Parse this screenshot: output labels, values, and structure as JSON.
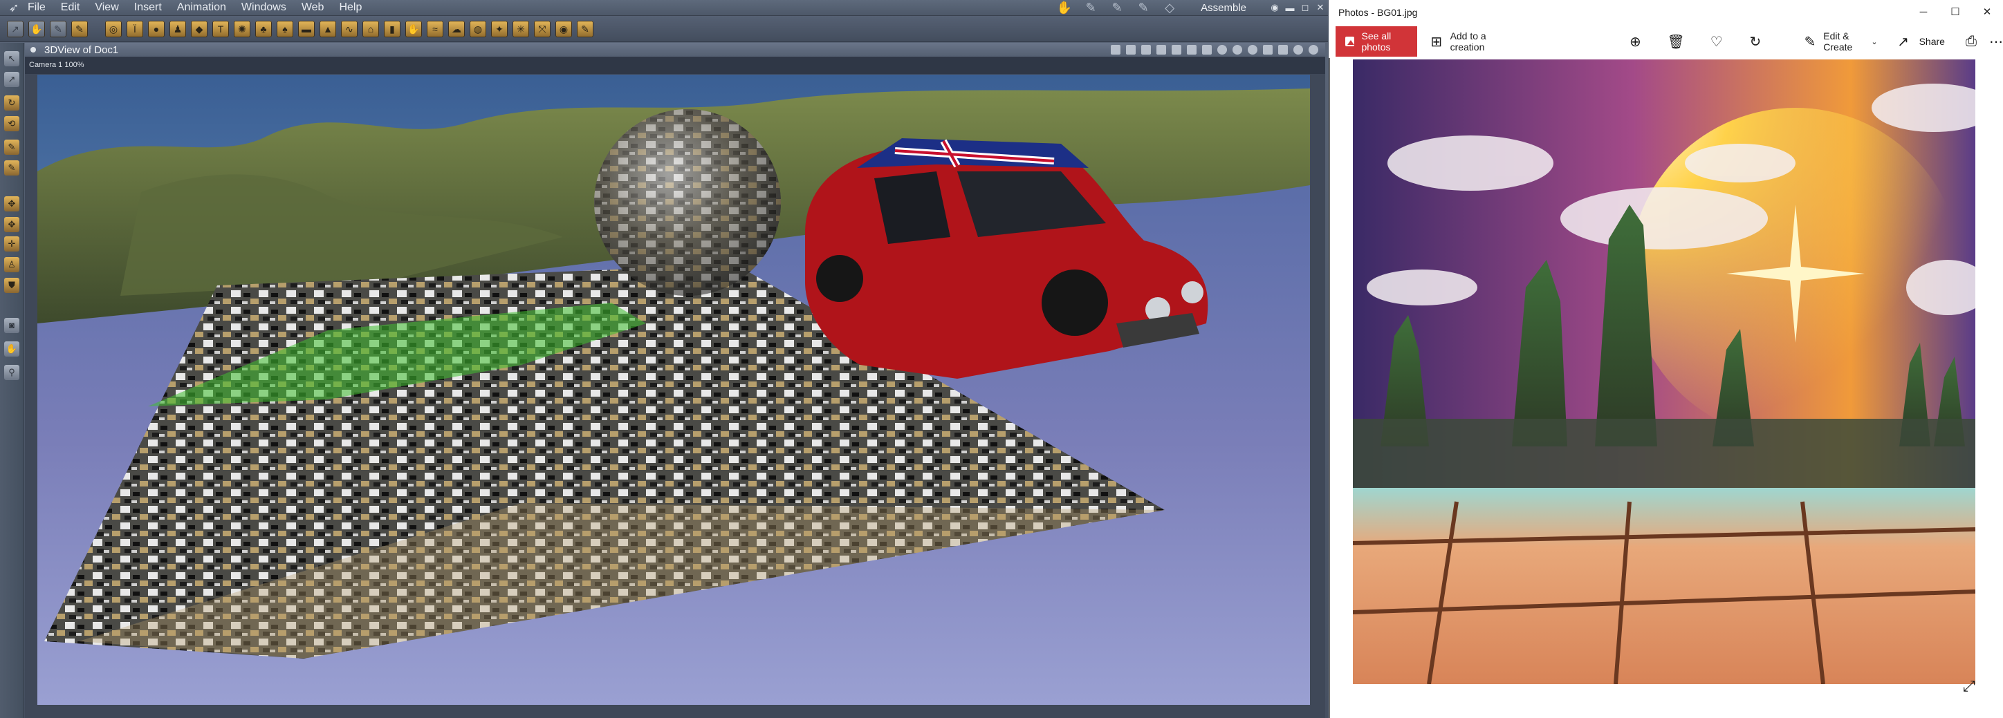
{
  "carrara": {
    "menus": [
      "File",
      "Edit",
      "View",
      "Insert",
      "Animation",
      "Windows",
      "Web",
      "Help"
    ],
    "room": "Assemble",
    "view_title": "3DView of Doc1",
    "camera_label": "Camera 1 100%"
  },
  "photos": {
    "title": "Photos - BG01.jpg",
    "see_all": "See all photos",
    "add_creation": "Add to a creation",
    "edit_create": "Edit & Create",
    "share": "Share",
    "accent": "#d13438"
  }
}
